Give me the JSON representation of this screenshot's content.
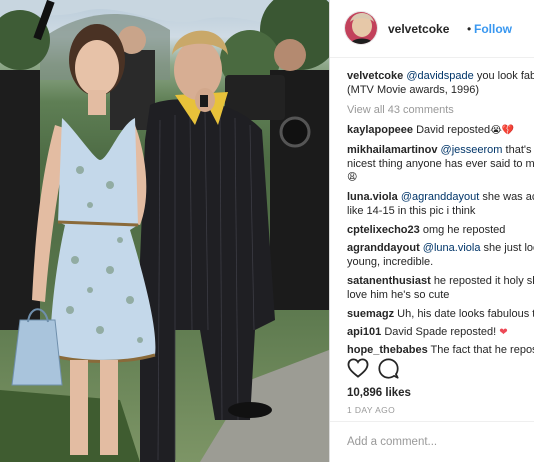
{
  "post": {
    "username": "velvetcoke",
    "separator": "•",
    "follow_label": "Follow",
    "caption": {
      "user": "velvetcoke",
      "mention": "@davidspade",
      "text": "you look fabu",
      "line2": "(MTV Movie awards, 1996)"
    },
    "view_all": "View all 43 comments",
    "comments": [
      {
        "user": "kaylapopeee",
        "text": "David reposted",
        "emoji": "😭💔",
        "mention": ""
      },
      {
        "user": "mikhailamartinov",
        "mention": "@jesseerom",
        "text": "that's th",
        "line2": "nicest thing anyone has ever said to me",
        "line3_emoji": "😩"
      },
      {
        "user": "luna.viola",
        "mention": "@agranddayout",
        "text": "she was actu",
        "line2": "like 14-15 in this pic i think"
      },
      {
        "user": "cptelixecho23",
        "text": "omg he reposted",
        "mention": ""
      },
      {
        "user": "agranddayout",
        "mention": "@luna.viola",
        "text": "she just look",
        "line2": "young, incredible."
      },
      {
        "user": "satanenthusiast",
        "text": "he reposted it holy shi",
        "mention": "",
        "line2": "love him he's so cute"
      },
      {
        "user": "suemagz",
        "text": "Uh, his date looks fabulous to",
        "mention": ""
      },
      {
        "user": "api101",
        "text": "David Spade reposted!",
        "emoji": "❤",
        "mention": ""
      },
      {
        "user": "hope_thebabes",
        "text": "The fact that he repost",
        "mention": ""
      }
    ],
    "icons": [
      "heart-icon",
      "comment-icon"
    ],
    "likes": "10,896 likes",
    "time_ago": "1 DAY AGO",
    "add_comment_placeholder": "Add a comment..."
  },
  "colors": {
    "link_blue": "#3897f0",
    "mention_blue": "#003569",
    "muted_gray": "#999999",
    "heart_red": "#ed4956"
  }
}
